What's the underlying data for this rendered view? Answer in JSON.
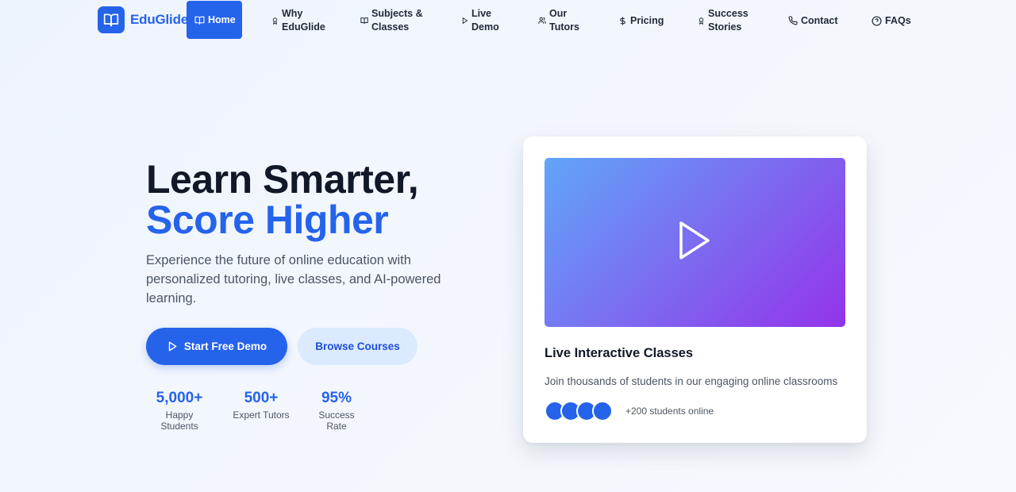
{
  "brand": {
    "name": "EduGlide",
    "color": "#2563eb"
  },
  "nav": {
    "items": [
      {
        "label": "Home",
        "icon": "book-open-icon",
        "active": true
      },
      {
        "label": "Why EduGlide",
        "icon": "award-icon"
      },
      {
        "label": "Subjects & Classes",
        "icon": "book-open-icon"
      },
      {
        "label": "Live Demo",
        "icon": "play-icon"
      },
      {
        "label": "Our Tutors",
        "icon": "users-icon"
      },
      {
        "label": "Pricing",
        "icon": "dollar-icon"
      },
      {
        "label": "Success Stories",
        "icon": "award-icon"
      },
      {
        "label": "Contact",
        "icon": "phone-icon"
      },
      {
        "label": "FAQs",
        "icon": "help-circle-icon"
      }
    ]
  },
  "hero": {
    "title_line1": "Learn Smarter,",
    "title_line2": "Score Higher",
    "subtitle": "Experience the future of online education with personalized tutoring, live classes, and AI-powered learning.",
    "primary_button": "Start Free Demo",
    "secondary_button": "Browse Courses",
    "stats": [
      {
        "value": "5,000+",
        "label": "Happy Students"
      },
      {
        "value": "500+",
        "label": "Expert Tutors"
      },
      {
        "value": "95%",
        "label": "Success Rate"
      }
    ]
  },
  "card": {
    "title": "Live Interactive Classes",
    "description": "Join thousands of students in our engaging online classrooms",
    "online_text": "+200 students online",
    "avatar_count": 4
  }
}
